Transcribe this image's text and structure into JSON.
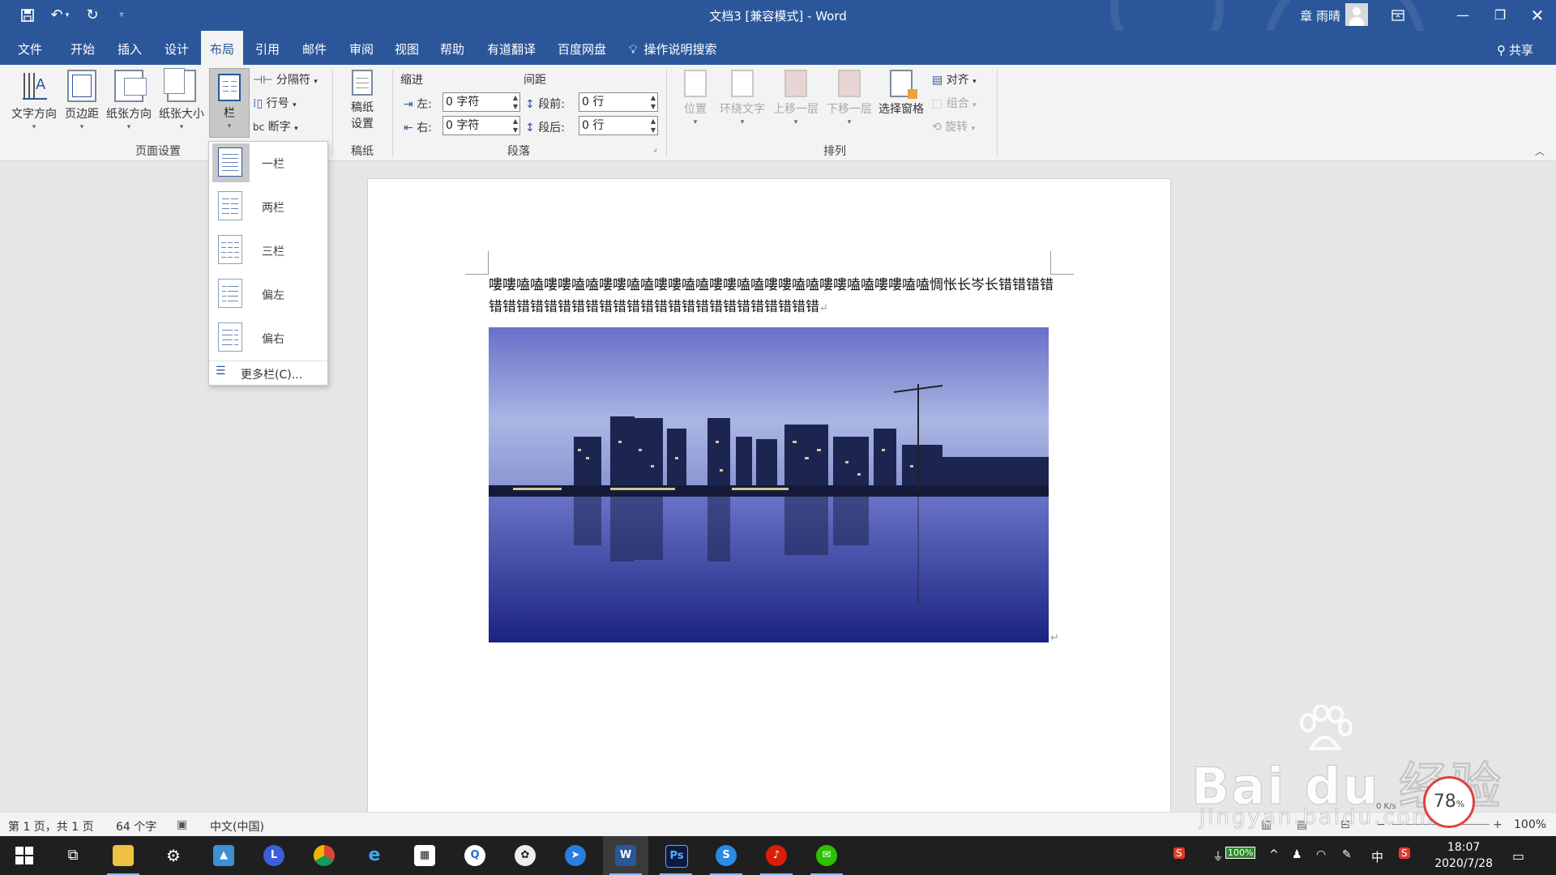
{
  "window": {
    "title": "文档3 [兼容模式] - Word",
    "user": "章 雨晴",
    "share_label": "共享"
  },
  "tabs": [
    {
      "label": "文件"
    },
    {
      "label": "开始"
    },
    {
      "label": "插入"
    },
    {
      "label": "设计"
    },
    {
      "label": "布局",
      "active": true
    },
    {
      "label": "引用"
    },
    {
      "label": "邮件"
    },
    {
      "label": "审阅"
    },
    {
      "label": "视图"
    },
    {
      "label": "帮助"
    },
    {
      "label": "有道翻译"
    },
    {
      "label": "百度网盘"
    },
    {
      "label": "操作说明搜索"
    }
  ],
  "ribbon": {
    "page_setup": {
      "text_direction": "文字方向",
      "margins": "页边距",
      "orientation": "纸张方向",
      "size": "纸张大小",
      "columns": "栏",
      "breaks": "分隔符",
      "line_numbers": "行号",
      "hyphenation": "断字",
      "group_label": "页面设置"
    },
    "manuscript": {
      "button_line1": "稿纸",
      "button_line2": "设置",
      "group_label": "稿纸"
    },
    "paragraph": {
      "indent_label": "缩进",
      "spacing_label": "间距",
      "left_label": "左:",
      "right_label": "右:",
      "before_label": "段前:",
      "after_label": "段后:",
      "left_value": "0 字符",
      "right_value": "0 字符",
      "before_value": "0 行",
      "after_value": "0 行",
      "group_label": "段落"
    },
    "arrange": {
      "position": "位置",
      "wrap_text": "环绕文字",
      "bring_forward": "上移一层",
      "send_backward": "下移一层",
      "selection_pane": "选择窗格",
      "align": "对齐",
      "group": "组合",
      "rotate": "旋转",
      "group_label": "排列"
    }
  },
  "columns_menu": {
    "items": [
      {
        "label": "一栏",
        "selected": true
      },
      {
        "label": "两栏"
      },
      {
        "label": "三栏"
      },
      {
        "label": "偏左"
      },
      {
        "label": "偏右"
      }
    ],
    "more": "更多栏(C)..."
  },
  "document": {
    "text": "嘍嘍嗑嗑嘍嘍嗑嗑嘍嘍嗑嗑嘍嘍嗑嗑嘍嘍嗑嗑嘍嘍嗑嗑嘍嘍嗑嗑嘍嘍嗑嗑惆怅长岑长错错错错错错错错错错错错错错错错错错错错错错错错错错错错"
  },
  "statusbar": {
    "page": "第 1 页，共 1 页",
    "words": "64 个字",
    "language": "中文(中国)",
    "zoom": "100%"
  },
  "taskbar": {
    "battery": "100%",
    "ime": "中",
    "time": "18:07",
    "date": "2020/7/28",
    "speed_percent": "78",
    "speed_unit": "%",
    "net_speed": "0 K/s"
  },
  "watermark": {
    "brand": "Bai du 经验",
    "url": "jingyan.baidu.com"
  },
  "colors": {
    "word_blue": "#2b579a",
    "ribbon_bg": "#f3f3f3",
    "taskbar": "#1f1f1f"
  }
}
